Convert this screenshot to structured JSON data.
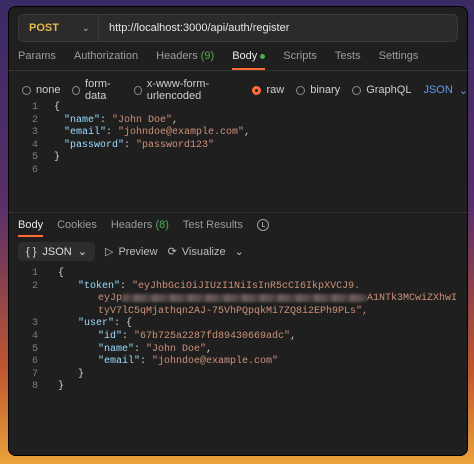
{
  "request": {
    "method": "POST",
    "url": "http://localhost:3000/api/auth/register"
  },
  "request_tabs": [
    {
      "label": "Params"
    },
    {
      "label": "Authorization"
    },
    {
      "label": "Headers",
      "count": "(9)"
    },
    {
      "label": "Body",
      "active": true
    },
    {
      "label": "Scripts"
    },
    {
      "label": "Tests"
    },
    {
      "label": "Settings"
    }
  ],
  "body_types": {
    "none": "none",
    "form_data": "form-data",
    "urlencoded": "x-www-form-urlencoded",
    "raw": "raw",
    "binary": "binary",
    "graphql": "GraphQL",
    "language": "JSON"
  },
  "request_body": {
    "line_numbers": [
      "1",
      "2",
      "3",
      "4",
      "5",
      "6"
    ],
    "open": "{",
    "name_key": "\"name\"",
    "name_val": "\"John Doe\"",
    "email_key": "\"email\"",
    "email_val": "\"johndoe@example.com\"",
    "password_key": "\"password\"",
    "password_val": "\"password123\"",
    "close": "}"
  },
  "response_tabs": {
    "body": "Body",
    "cookies": "Cookies",
    "headers": "Headers",
    "headers_count": "(8)",
    "test_results": "Test Results"
  },
  "response_toolbar": {
    "format": "JSON",
    "preview": "Preview",
    "visualize": "Visualize"
  },
  "response_body": {
    "line_numbers": [
      "1",
      "2",
      "",
      "",
      "3",
      "4",
      "5",
      "6",
      "7",
      "8"
    ],
    "open": "{",
    "token_key": "\"token\"",
    "token_line1": "\"eyJhbGciOiJIUzI1NiIsInR5cCI6IkpXVCJ9.",
    "token_line2_start": "eyJp",
    "token_line2_end": "A1NTk3MCwiZXhwI",
    "token_line3": "tyV7lC5qMjathqn2AJ-75VhPQpqkMi7ZQ8i2EPh9PLs\",",
    "user_key": "\"user\"",
    "id_key": "\"id\"",
    "id_val": "\"67b725a2287fd89430669adc\"",
    "name_key": "\"name\"",
    "name_val": "\"John Doe\"",
    "email_key": "\"email\"",
    "email_val": "\"johndoe@example.com\"",
    "close_inner": "}",
    "close": "}"
  },
  "colors": {
    "accent": "#ff6c37",
    "method": "#e6b84a",
    "json_key": "#9cdcfe",
    "json_string": "#ce9178",
    "status_green": "#4caf50"
  }
}
